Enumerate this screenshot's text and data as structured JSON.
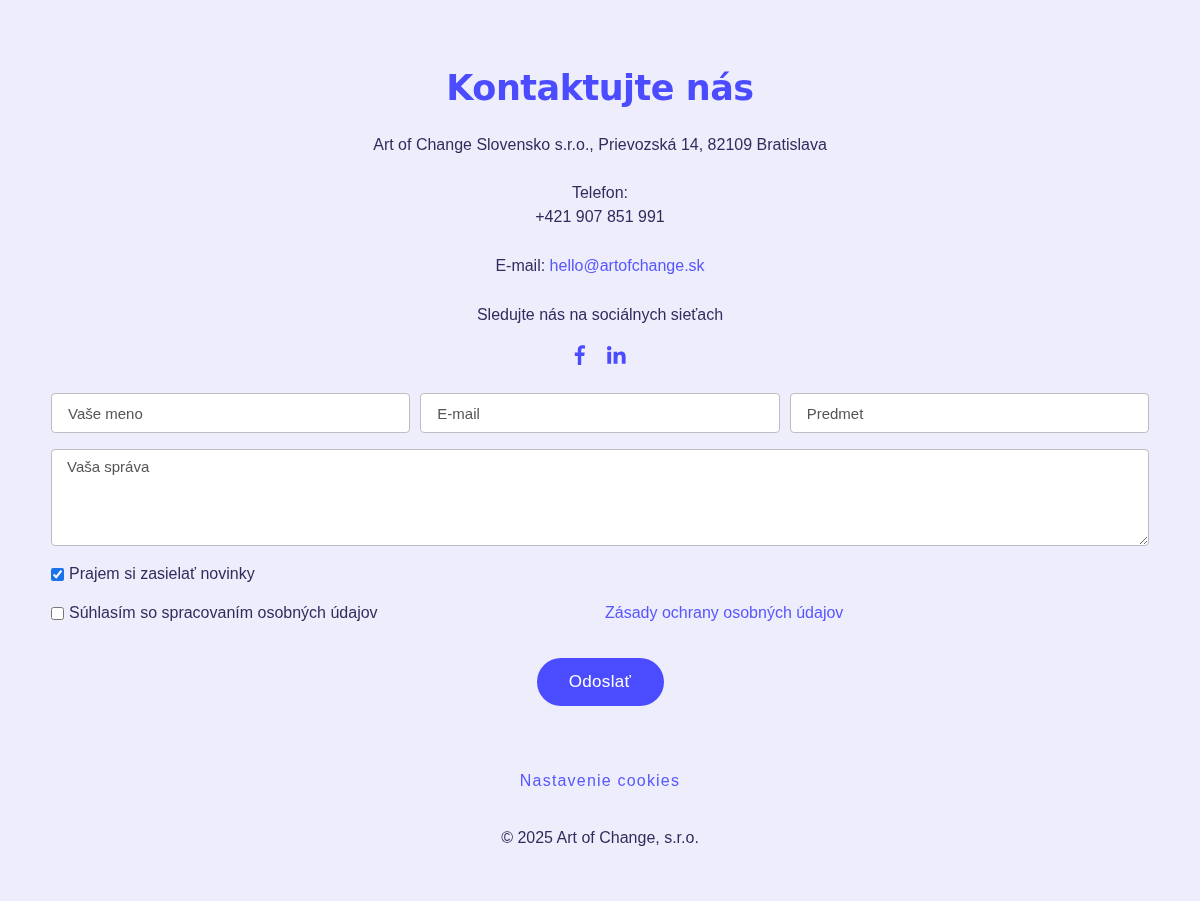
{
  "heading": "Kontaktujte nás",
  "address": "Art of Change Slovensko s.r.o., Prievozská 14, 82109 Bratislava",
  "phone": {
    "label": "Telefon:",
    "value": "+421 907 851 991"
  },
  "email": {
    "label": "E-mail:",
    "link": "hello@artofchange.sk"
  },
  "social": {
    "title": "Sledujte nás na sociálnych sieťach"
  },
  "form": {
    "fields": [
      {
        "placeholder": "Vaše meno"
      },
      {
        "placeholder": "E-mail"
      },
      {
        "placeholder": "Predmet"
      }
    ],
    "message": {
      "placeholder": "Vaša správa"
    },
    "checkboxes": [
      {
        "label": "Prajem si zasielať novinky",
        "checked": true
      },
      {
        "label": "Súhlasím so spracovaním osobných údajov",
        "checked": false
      }
    ],
    "privacy_link": "Zásady ochrany osobných údajov",
    "submit": "Odoslať"
  },
  "footer": {
    "cookies_link": "Nastavenie cookies",
    "copyright": "© 2025 Art of Change, s.r.o."
  }
}
